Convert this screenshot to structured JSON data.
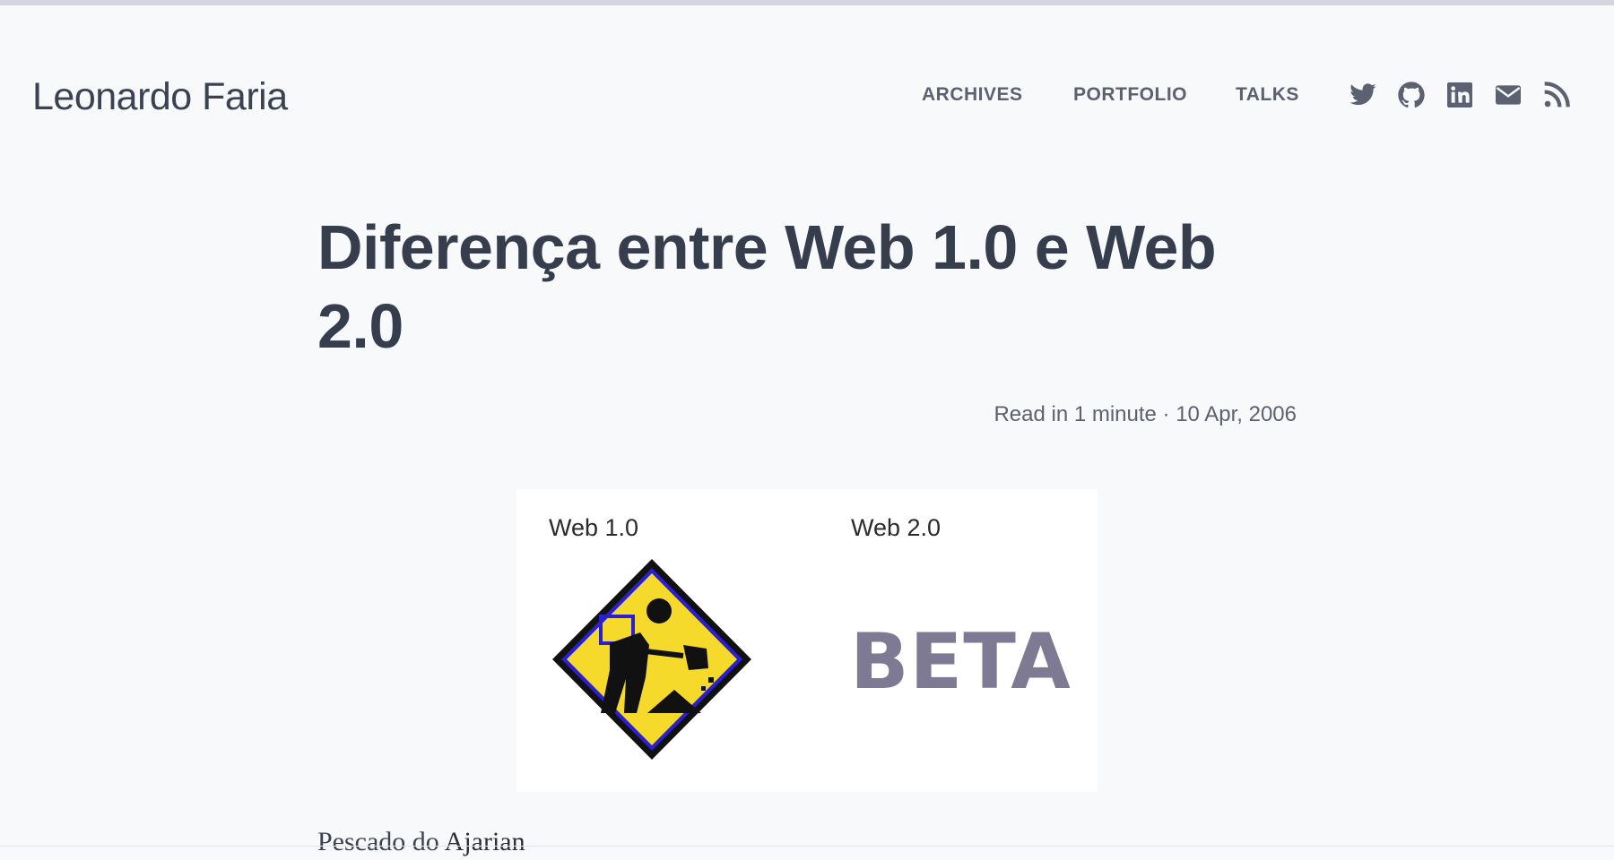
{
  "site": {
    "title": "Leonardo Faria"
  },
  "nav": {
    "items": [
      {
        "label": "ARCHIVES"
      },
      {
        "label": "PORTFOLIO"
      },
      {
        "label": "TALKS"
      }
    ],
    "social": [
      {
        "icon": "twitter-icon"
      },
      {
        "icon": "github-icon"
      },
      {
        "icon": "linkedin-icon"
      },
      {
        "icon": "email-icon"
      },
      {
        "icon": "rss-icon"
      }
    ],
    "icon_color": "#5b6170"
  },
  "post": {
    "title": "Diferença entre Web 1.0 e Web 2.0",
    "meta": "Read in 1 minute · 10 Apr, 2006",
    "figure": {
      "left_label": "Web 1.0",
      "right_label": "Web 2.0",
      "right_badge": "BETA",
      "left_image": "under-construction-sign"
    },
    "body": {
      "prefix": "Pescado do ",
      "link": "Ajarian"
    }
  },
  "colors": {
    "background": "#f8f9fb",
    "text": "#363d4c",
    "sign_yellow": "#f5d92b",
    "beta": "#7e7a93"
  }
}
